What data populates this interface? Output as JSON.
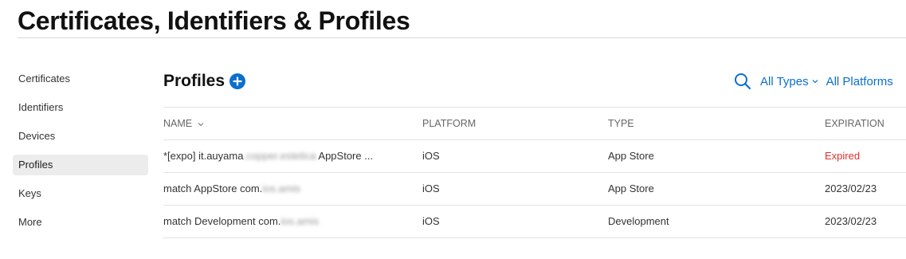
{
  "header": {
    "title": "Certificates, Identifiers & Profiles"
  },
  "sidebar": {
    "items": [
      {
        "label": "Certificates",
        "active": false
      },
      {
        "label": "Identifiers",
        "active": false
      },
      {
        "label": "Devices",
        "active": false
      },
      {
        "label": "Profiles",
        "active": true
      },
      {
        "label": "Keys",
        "active": false
      },
      {
        "label": "More",
        "active": false
      }
    ]
  },
  "section": {
    "title": "Profiles",
    "add_icon": "plus-circle-icon"
  },
  "filters": {
    "search_icon": "search-icon",
    "types_label": "All Types",
    "platforms_label": "All Platforms"
  },
  "table": {
    "columns": [
      "NAME",
      "PLATFORM",
      "TYPE",
      "EXPIRATION"
    ],
    "rows": [
      {
        "name_prefix": "*[expo] it.auyama",
        "name_blurred": ".copper.estetica",
        "name_suffix": " AppStore ...",
        "platform": "iOS",
        "type": "App Store",
        "expiration": "Expired"
      },
      {
        "name_prefix": "match AppStore com.",
        "name_blurred": "ios.amis",
        "name_suffix": "",
        "platform": "iOS",
        "type": "App Store",
        "expiration": "2023/02/23"
      },
      {
        "name_prefix": "match Development com.",
        "name_blurred": "ios.amis",
        "name_suffix": "",
        "platform": "iOS",
        "type": "Development",
        "expiration": "2023/02/23"
      }
    ]
  },
  "colors": {
    "accent": "#0b6fce",
    "expired": "#e0302a",
    "active_bg": "#ececec"
  }
}
